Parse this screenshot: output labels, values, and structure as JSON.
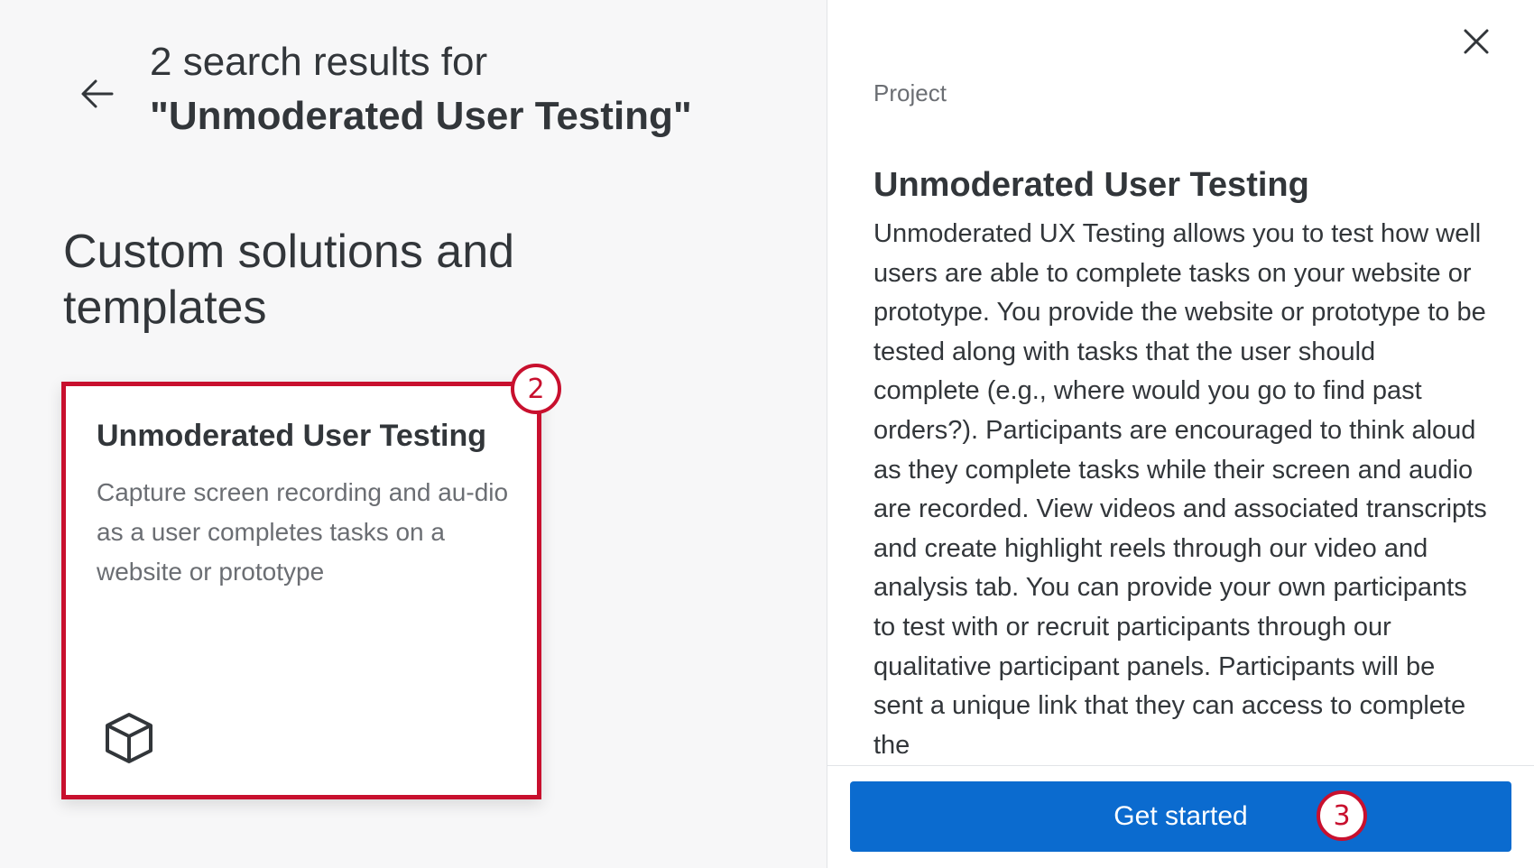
{
  "search": {
    "results_line": "2 search results for",
    "query": "\"Unmoderated User Testing\""
  },
  "section": {
    "heading": "Custom solutions and templates"
  },
  "card": {
    "title": "Unmoderated User Testing",
    "description": "Capture screen recording and au-dio as a user completes tasks on a website or prototype",
    "icon": "cube-icon"
  },
  "detail": {
    "type_label": "Project",
    "title": "Unmoderated User Testing",
    "description": "Unmoderated UX Testing allows you to test how well users are able to complete tasks on your website or prototype. You provide the website or prototype to be tested along with tasks that the user should complete (e.g., where would you go to find past orders?). Participants are encouraged to think aloud as they complete tasks while their screen and audio are recorded. View videos and associated transcripts and create highlight reels through our video and analysis tab. You can provide your own participants to test with or recruit participants through our qualitative participant panels. Participants will be sent a unique link that they can access to complete the",
    "cta_label": "Get started"
  },
  "steps": {
    "card_step": "2",
    "cta_step": "3"
  },
  "icons": {
    "back": "arrow-left-icon",
    "close": "close-icon"
  },
  "colors": {
    "accent": "#0b6bcf",
    "highlight": "#c8102e"
  }
}
